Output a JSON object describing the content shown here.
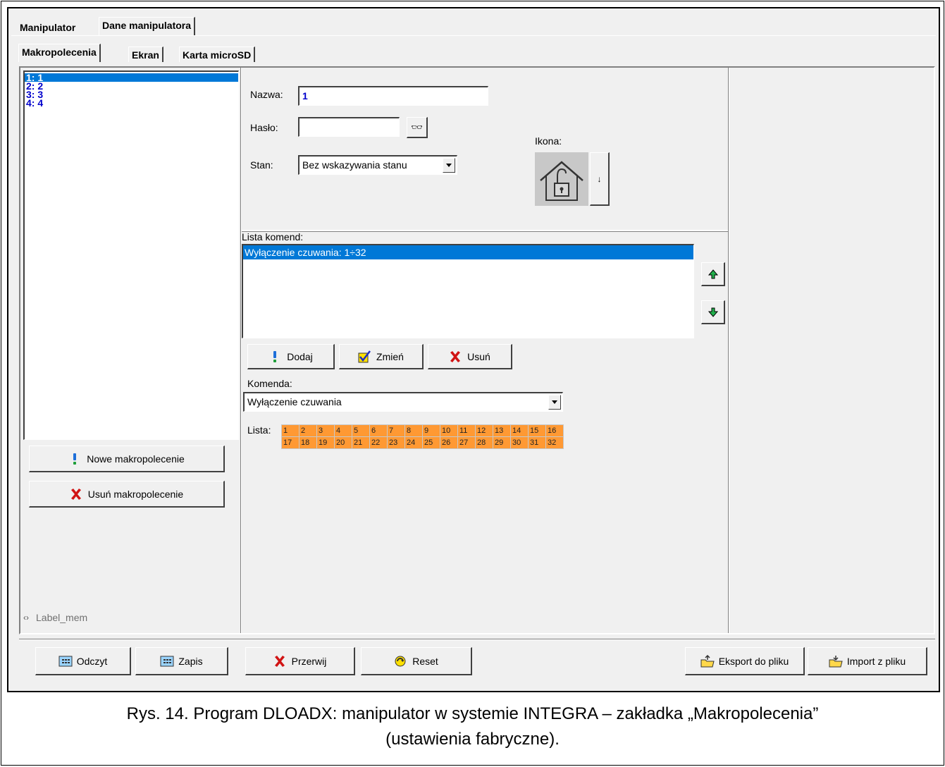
{
  "tabs_top": [
    {
      "label": "Manipulator",
      "active": false
    },
    {
      "label": "Dane manipulatora",
      "active": true
    }
  ],
  "tabs_sub": [
    {
      "label": "Makropolecenia",
      "active": true
    },
    {
      "label": "Ekran",
      "active": false
    },
    {
      "label": "Karta microSD",
      "active": false
    }
  ],
  "macro_list": [
    {
      "label": "1: 1",
      "selected": true
    },
    {
      "label": "2: 2",
      "selected": false
    },
    {
      "label": "3: 3",
      "selected": false
    },
    {
      "label": "4: 4",
      "selected": false
    }
  ],
  "left_buttons": {
    "new_macro": "Nowe makropolecenie",
    "delete_macro": "Usuń makropolecenie"
  },
  "label_mem": "Label_mem",
  "form": {
    "name_label": "Nazwa:",
    "name_value": "1",
    "password_label": "Hasło:",
    "password_value": "",
    "state_label": "Stan:",
    "state_value": "Bez wskazywania stanu",
    "icon_label": "Ikona:"
  },
  "commands": {
    "list_label": "Lista komend:",
    "items": [
      {
        "label": "Wyłączenie czuwania: 1÷32",
        "selected": true
      }
    ],
    "add_label": "Dodaj",
    "change_label": "Zmień",
    "remove_label": "Usuń",
    "command_label": "Komenda:",
    "command_value": "Wyłączenie czuwania",
    "list_grid_label": "Lista:",
    "grid_row1": [
      "1",
      "2",
      "3",
      "4",
      "5",
      "6",
      "7",
      "8",
      "9",
      "10",
      "11",
      "12",
      "13",
      "14",
      "15",
      "16"
    ],
    "grid_row2": [
      "17",
      "18",
      "19",
      "20",
      "21",
      "22",
      "23",
      "24",
      "25",
      "26",
      "27",
      "28",
      "29",
      "30",
      "31",
      "32"
    ]
  },
  "bottom_buttons": {
    "read": "Odczyt",
    "write": "Zapis",
    "abort": "Przerwij",
    "reset": "Reset",
    "export": "Eksport do pliku",
    "import": "Import z pliku"
  },
  "caption": {
    "line1": "Rys. 14. Program DLOADX: manipulator w systemie INTEGRA – zakładka „Makropolecenia”",
    "line2": "(ustawienia fabryczne)."
  },
  "colors": {
    "selection": "#0078d7",
    "grid_cell": "#ff9933",
    "list_text": "#0000cc"
  }
}
